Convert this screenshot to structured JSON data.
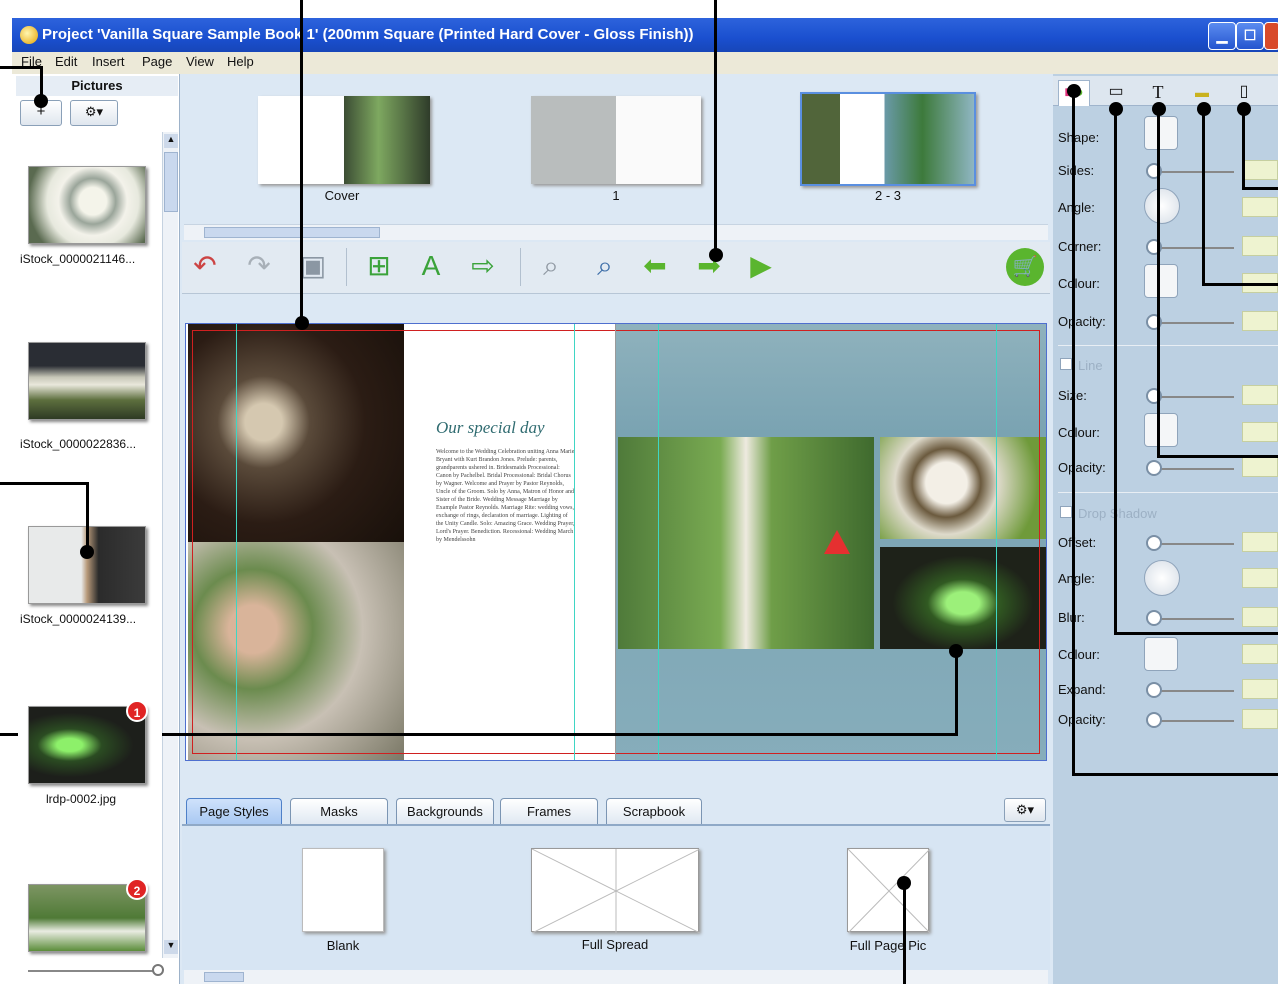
{
  "window": {
    "title": "Project 'Vanilla Square Sample Book 1' (200mm Square (Printed Hard Cover - Gloss Finish))"
  },
  "menu": [
    "File",
    "Edit",
    "Insert",
    "Page",
    "View",
    "Help"
  ],
  "pictures_panel": {
    "title": "Pictures",
    "add_label": "+",
    "items": [
      {
        "label": "iStock_0000021146..."
      },
      {
        "label": "iStock_0000022836..."
      },
      {
        "label": "iStock_0000024139..."
      },
      {
        "label": "lrdp-0002.jpg",
        "badge": "1"
      },
      {
        "label": "",
        "badge": "2"
      }
    ]
  },
  "pages": [
    {
      "label": "Cover"
    },
    {
      "label": "1"
    },
    {
      "label": "2 - 3"
    }
  ],
  "spread": {
    "heading": "Our special day",
    "body_text": "Welcome to the Wedding Celebration uniting Anna Marie Bryant with Kurt Brandon Jones. Prelude: parents, grandparents ushered in. Bridesmaids Processional: Canon by Pachelbel. Bridal Processional: Bridal Chorus by Wagner. Welcome and Prayer by Pastor Reynolds, Uncle of the Groom. Solo by Anna, Matron of Honor and Sister of the Bride. Wedding Message Marriage by Example Pastor Reynolds. Marriage Rite: wedding vows, exchange of rings, declaration of marriage. Lighting of the Unity Candle. Solo: Amazing Grace. Wedding Prayer, Lord's Prayer. Benediction. Recessional: Wedding March by Mendelssohn"
  },
  "bottom_tabs": [
    "Page Styles",
    "Masks",
    "Backgrounds",
    "Frames",
    "Scrapbook"
  ],
  "page_styles": [
    {
      "label": "Blank"
    },
    {
      "label": "Full Spread"
    },
    {
      "label": "Full Page Pic"
    }
  ],
  "properties": {
    "shape_label": "Shape:",
    "sides_label": "Sides:",
    "angle_label": "Angle:",
    "corner_label": "Corner:",
    "colour_label": "Colour:",
    "opacity_label": "Opacity:",
    "line_label": "Line",
    "size_label": "Size:",
    "line_colour_label": "Colour:",
    "line_opacity_label": "Opacity:",
    "drop_shadow_label": "Drop Shadow",
    "offset_label": "Offset:",
    "shadow_angle_label": "Angle:",
    "blur_label": "Blur:",
    "shadow_colour_label": "Colour:",
    "expand_label": "Expand:",
    "shadow_opacity_label": "Opacity:"
  },
  "colors": {
    "titlebar": "#1a4fcf",
    "accent_green": "#5ab52e",
    "guide_cyan": "#3fd6c4",
    "bleed_red": "#d02020"
  }
}
